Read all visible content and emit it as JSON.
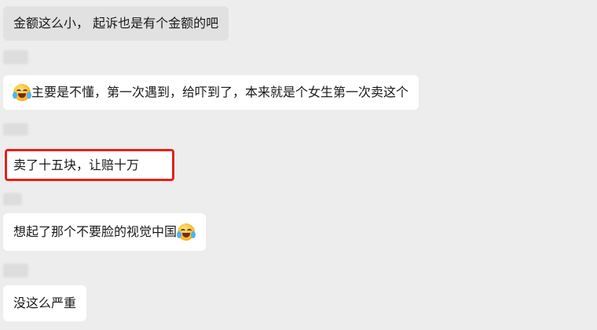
{
  "messages": [
    {
      "text": "金额这么小， 起诉也是有个金额的吧"
    },
    {
      "emoji": "laughing-crying-emoji",
      "text": "主要是不懂，第一次遇到，给吓到了，本来就是个女生第一次卖这个"
    },
    {
      "text": "卖了十五块，让赔十万"
    },
    {
      "text": "想起了那个不要脸的视觉中国",
      "emoji": "laughing-crying-emoji"
    },
    {
      "text": "没这么严重"
    }
  ],
  "colors": {
    "background": "#ededed",
    "bubble_white": "#ffffff",
    "bubble_gray": "#e1e1e1",
    "highlight_border": "#e8201a"
  }
}
